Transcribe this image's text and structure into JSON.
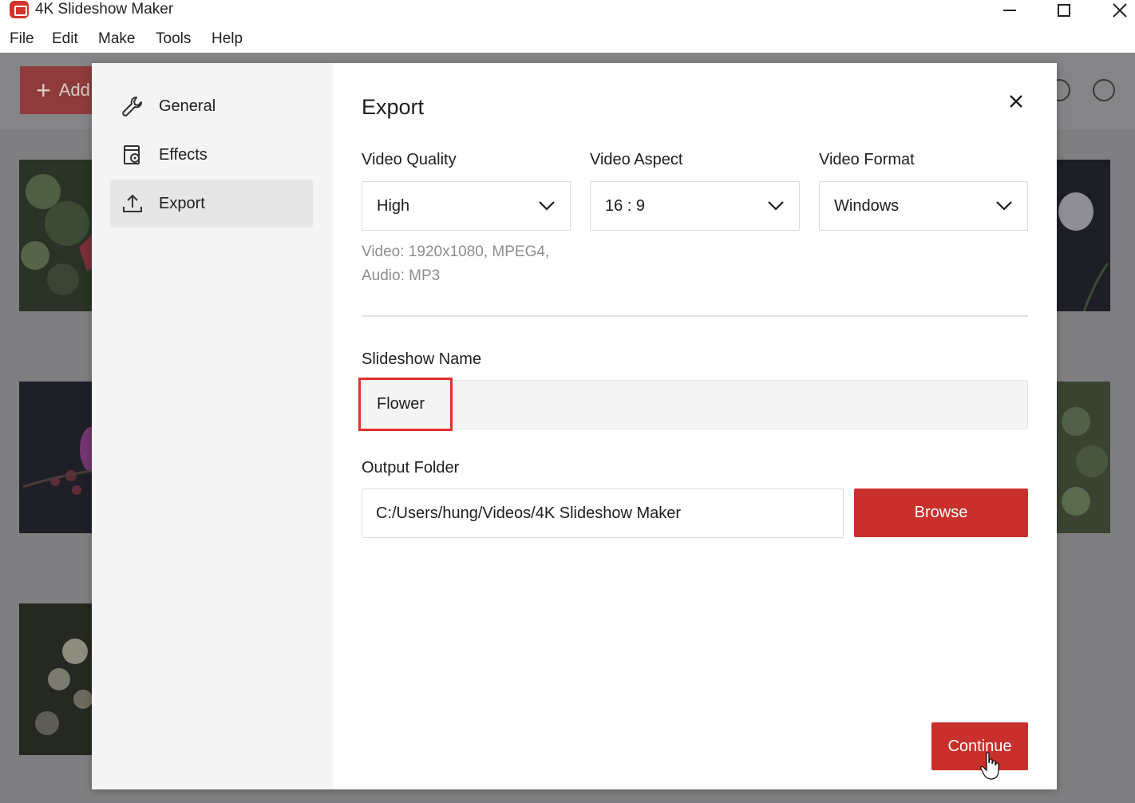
{
  "window": {
    "title": "4K Slideshow Maker"
  },
  "menu": [
    "File",
    "Edit",
    "Make",
    "Tools",
    "Help"
  ],
  "background": {
    "add_button_label": "Add"
  },
  "dialog": {
    "sidebar": [
      {
        "label": "General",
        "icon": "wrench-icon"
      },
      {
        "label": "Effects",
        "icon": "effects-icon"
      },
      {
        "label": "Export",
        "icon": "upload-icon",
        "active": true
      }
    ],
    "title": "Export",
    "video_quality": {
      "label": "Video Quality",
      "value": "High"
    },
    "video_aspect": {
      "label": "Video Aspect",
      "value": "16 : 9"
    },
    "video_format": {
      "label": "Video Format",
      "value": "Windows"
    },
    "hint_line1": "Video: 1920x1080, MPEG4,",
    "hint_line2": "Audio: MP3",
    "slideshow_name": {
      "label": "Slideshow Name",
      "value": "Flower"
    },
    "output_folder": {
      "label": "Output Folder",
      "value": "C:/Users/hung/Videos/4K Slideshow Maker"
    },
    "browse_label": "Browse",
    "continue_label": "Continue"
  },
  "colors": {
    "accent": "#c9302c",
    "highlight": "#e2302c"
  }
}
